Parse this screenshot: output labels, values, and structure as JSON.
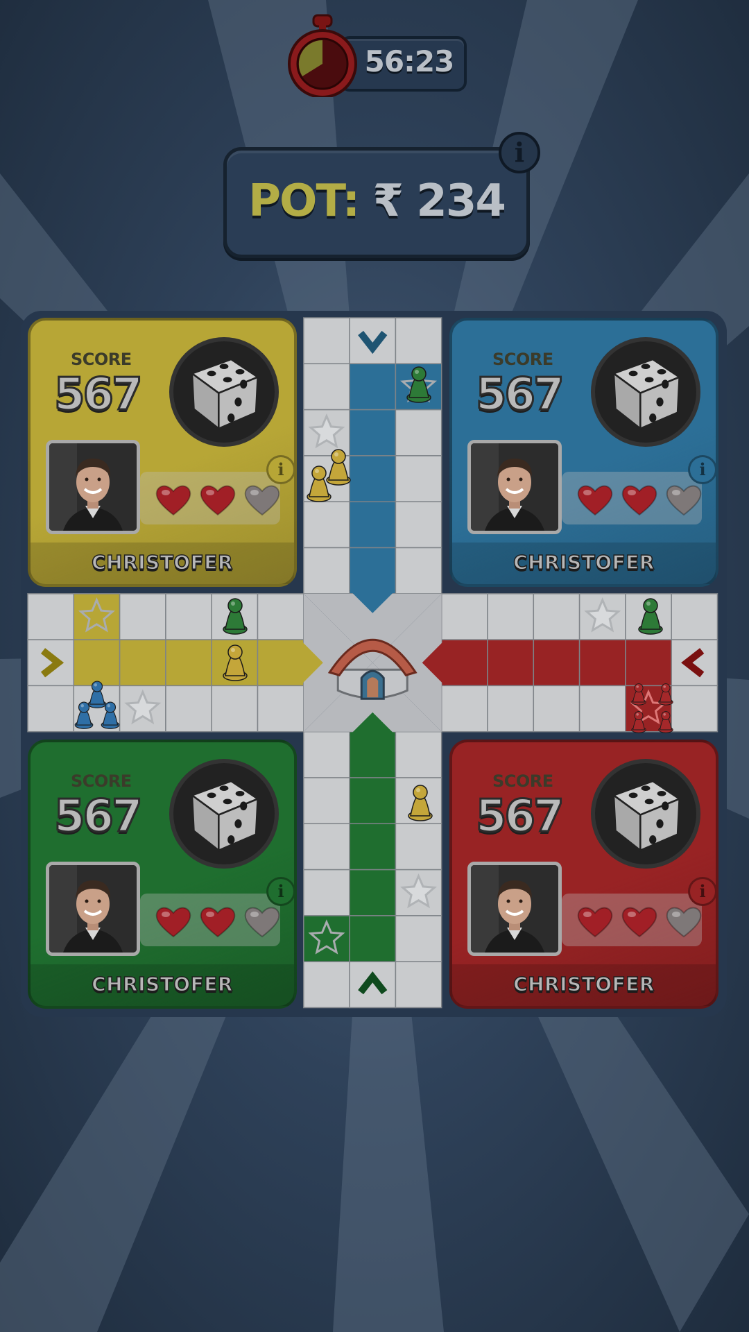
{
  "timer": {
    "value": "56:23",
    "icon": "stopwatch-icon"
  },
  "pot": {
    "label": "POT:",
    "value": "₹ 234",
    "info_icon": "i"
  },
  "players": [
    {
      "id": "yellow",
      "color": "#b7a636",
      "score_label": "SCORE",
      "score": "567",
      "name": "CHRISTOFER",
      "lives_total": 3,
      "lives_remaining": 2,
      "info": "i"
    },
    {
      "id": "blue",
      "color": "#2c6f97",
      "score_label": "SCORE",
      "score": "567",
      "name": "CHRISTOFER",
      "lives_total": 3,
      "lives_remaining": 2,
      "info": "i"
    },
    {
      "id": "green",
      "color": "#1f6e2f",
      "score_label": "SCORE",
      "score": "567",
      "name": "CHRISTOFER",
      "lives_total": 3,
      "lives_remaining": 2,
      "info": "i"
    },
    {
      "id": "red",
      "color": "#982324",
      "score_label": "SCORE",
      "score": "567",
      "name": "CHRISTOFER",
      "lives_total": 3,
      "lives_remaining": 2,
      "info": "i"
    }
  ],
  "colors": {
    "yellow": "#b7a636",
    "blue": "#2c6f97",
    "green": "#1f6e2f",
    "red": "#982324",
    "cell": "#c9cbcd",
    "home": "#b65b47"
  }
}
